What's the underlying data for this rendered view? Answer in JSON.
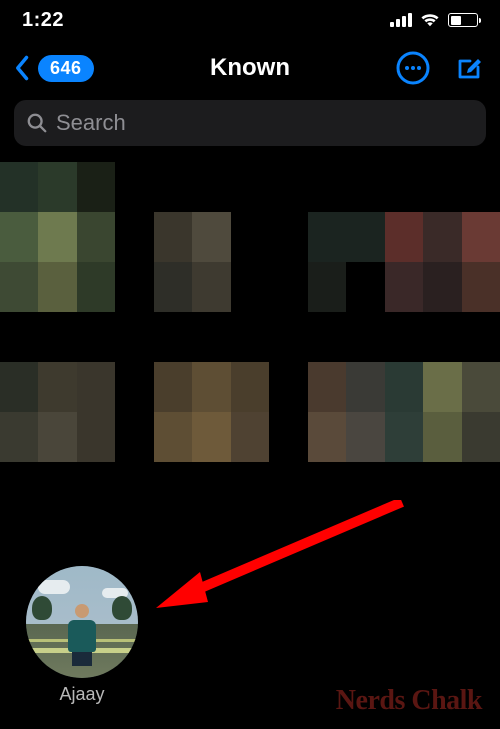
{
  "status": {
    "time": "1:22"
  },
  "nav": {
    "badge_count": "646",
    "title": "Known"
  },
  "search": {
    "placeholder": "Search"
  },
  "contact": {
    "name": "Ajaay"
  },
  "watermark": {
    "text": "Nerds Chalk"
  },
  "colors": {
    "accent": "#0a84ff",
    "arrow": "#ff0000"
  },
  "pixelated_rows": [
    [
      "#233127",
      "#2b3a2a",
      "#1a2016",
      "#000",
      "#000",
      "#000",
      "#000",
      "#000",
      "#000",
      "#000",
      "#000",
      "#000",
      "#000"
    ],
    [
      "#4a5c3e",
      "#6e7a4f",
      "#3a4630",
      "#000",
      "#3a362c",
      "#4f4a3d",
      "#000",
      "#000",
      "#1b2420",
      "#1b2420",
      "#5c2e2a",
      "#3a2a28",
      "#6a3a34"
    ],
    [
      "#3e4a34",
      "#5a603e",
      "#2e3a28",
      "#000",
      "#2e2e28",
      "#3e3a30",
      "#000",
      "#000",
      "#1a1e1a",
      "#000",
      "#3a2828",
      "#2a2020",
      "#4a3028"
    ],
    [
      "#000",
      "#000",
      "#000",
      "#000",
      "#000",
      "#000",
      "#000",
      "#000",
      "#000",
      "#000",
      "#000",
      "#000",
      "#000"
    ],
    [
      "#2a2e26",
      "#3e3a2e",
      "#3a362c",
      "#000",
      "#4a3e2c",
      "#5e4e34",
      "#4a3e2c",
      "#000",
      "#4a3a2e",
      "#3a3a36",
      "#2a3a34",
      "#6a6e48",
      "#4a4a3a"
    ],
    [
      "#3a3a30",
      "#4a463a",
      "#3a362c",
      "#000",
      "#5e4e34",
      "#6e5a3a",
      "#4f4232",
      "#000",
      "#5a4a3a",
      "#4a4640",
      "#2e3e38",
      "#5a5e3e",
      "#3a3a30"
    ],
    [
      "#000",
      "#000",
      "#000",
      "#000",
      "#000",
      "#000",
      "#000",
      "#000",
      "#000",
      "#000",
      "#000",
      "#000",
      "#000"
    ]
  ]
}
